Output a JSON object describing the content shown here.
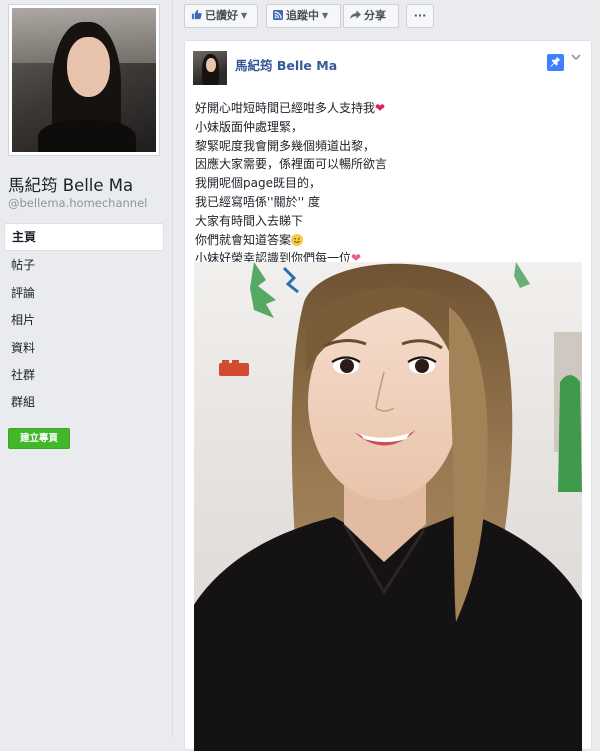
{
  "page": {
    "name": "馬紀筠 Belle Ma",
    "handle": "@bellema.homechannel"
  },
  "nav": {
    "items": [
      "主頁",
      "帖子",
      "評論",
      "相片",
      "資料",
      "社群",
      "群組"
    ],
    "active_index": 0,
    "create_page_label": "建立專頁"
  },
  "action_bar": {
    "liked_label": "已讚好",
    "following_label": "追蹤中",
    "share_label": "分享",
    "more_label": "···"
  },
  "post": {
    "author": "馬紀筠 Belle Ma",
    "lines": [
      "好開心咁短時間已經咁多人支持我",
      "小妹版面仲處理緊，",
      "黎緊呢度我會開多幾個頻道出黎，",
      "因應大家需要，係裡面可以暢所欲言",
      "我開呢個page既目的，",
      "我已經寫唔係''關於'' 度",
      "大家有時間入去睇下",
      "你們就會知道答案",
      "小妹好榮幸認識到你們每一位"
    ]
  },
  "colors": {
    "link_blue": "#365899",
    "create_green": "#42b72a",
    "pin_blue": "#4080ff"
  },
  "icons": [
    "thumbs-up-icon",
    "rss-icon",
    "share-arrow-icon",
    "pin-icon",
    "chevron-down-icon",
    "heart-emoji",
    "smile-emoji"
  ]
}
